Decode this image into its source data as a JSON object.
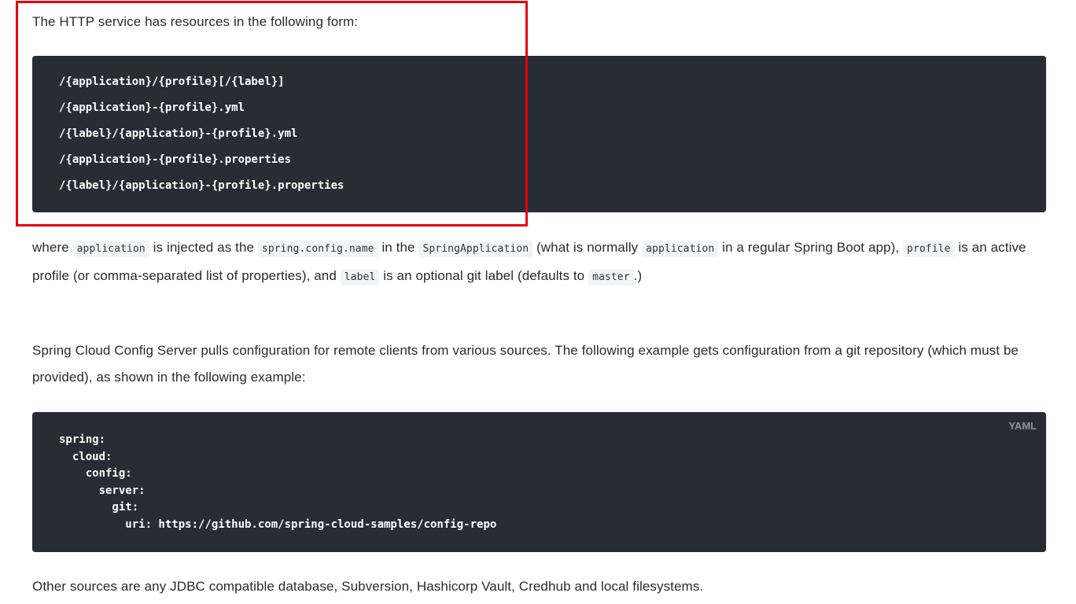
{
  "intro_text": "The HTTP service has resources in the following form:",
  "resource_paths": [
    "/{application}/{profile}[/{label}]",
    "/{application}-{profile}.yml",
    "/{label}/{application}-{profile}.yml",
    "/{application}-{profile}.properties",
    "/{label}/{application}-{profile}.properties"
  ],
  "para1": {
    "t1": "where ",
    "c1": "application",
    "t2": " is injected as the ",
    "c2": "spring.config.name",
    "t3": " in the ",
    "c3": "SpringApplication",
    "t4": " (what is normally ",
    "c4": "application",
    "t5": " in a regular Spring Boot app), ",
    "c5": "profile",
    "t6": " is an active profile (or comma-separated list of properties), and ",
    "c6": "label",
    "t7": " is an optional git label (defaults to ",
    "c7": "master",
    "t8": ".)"
  },
  "para2": "Spring Cloud Config Server pulls configuration for remote clients from various sources. The following example gets configuration from a git repository (which must be provided), as shown in the following example:",
  "yaml_block": {
    "language": "YAML",
    "code": "spring:\n  cloud:\n    config:\n      server:\n        git:\n          uri: https://github.com/spring-cloud-samples/config-repo"
  },
  "para3": "Other sources are any JDBC compatible database, Subversion, Hashicorp Vault, Credhub and local filesystems.",
  "colors": {
    "code_background": "#282c34",
    "highlight_border": "#e3000f",
    "inline_code_background": "#f3f4f5"
  }
}
